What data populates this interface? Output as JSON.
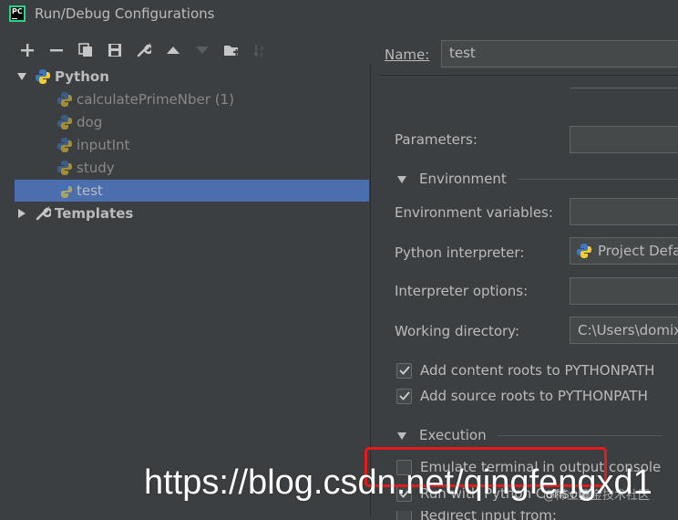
{
  "window": {
    "title": "Run/Debug Configurations",
    "app_icon_text": "PC"
  },
  "toolbar": {
    "buttons": [
      "add-icon",
      "remove-icon",
      "copy-icon",
      "save-icon",
      "wrench-icon",
      "move-up-icon",
      "move-down-icon",
      "folder-icon",
      "sort-icon"
    ]
  },
  "tree": {
    "python_label": "Python",
    "items": [
      "calculatePrimeNber (1)",
      "dog",
      "inputInt",
      "study",
      "test"
    ],
    "selected": "test",
    "templates_label": "Templates"
  },
  "form": {
    "name_label": "Name:",
    "name_value": "test",
    "parameters_label": "Parameters:",
    "environment_section": "Environment",
    "env_vars_label": "Environment variables:",
    "interpreter_label": "Python interpreter:",
    "interpreter_value": "Project Defa",
    "interp_options_label": "Interpreter options:",
    "working_dir_label": "Working directory:",
    "working_dir_value": "C:\\Users\\domix",
    "add_content_roots": {
      "label": "Add content roots to PYTHONPATH",
      "checked": true
    },
    "add_source_roots": {
      "label": "Add source roots to PYTHONPATH",
      "checked": true
    },
    "execution_section": "Execution",
    "emulate_terminal": {
      "label": "Emulate terminal in output console",
      "checked": false
    },
    "run_python_console": {
      "label": "Run with Python Console",
      "checked": true
    },
    "redirect_input": {
      "label": "Redirect input from:",
      "checked": false
    }
  },
  "watermark": {
    "text": "https://blog.csdn.net/qingfengxd1",
    "small_text": "@稀土掘金技术社区"
  },
  "colors": {
    "background": "#3c3f41",
    "selection": "#4b6eaf",
    "highlight_box": "#e21c1c",
    "text": "#bbbbbb"
  }
}
